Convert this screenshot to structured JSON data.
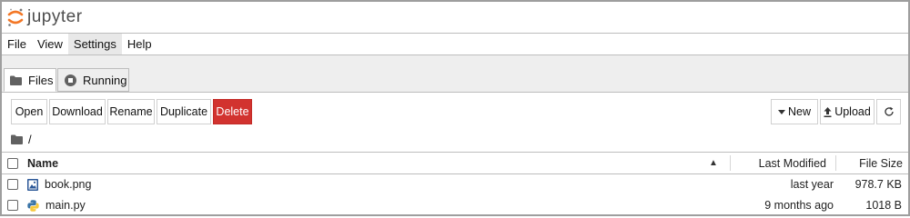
{
  "app": {
    "logo_text": "jupyter"
  },
  "menu": {
    "items": [
      "File",
      "View",
      "Settings",
      "Help"
    ],
    "active": "Settings"
  },
  "tabs": [
    {
      "label": "Files",
      "icon": "folder-icon",
      "selected": true
    },
    {
      "label": "Running",
      "icon": "stop-circle-icon",
      "selected": false
    }
  ],
  "toolbar": {
    "open_label": "Open",
    "download_label": "Download",
    "rename_label": "Rename",
    "duplicate_label": "Duplicate",
    "delete_label": "Delete",
    "new_label": "New",
    "upload_label": "Upload",
    "refresh_icon": "refresh-icon"
  },
  "breadcrumb": {
    "path": "/"
  },
  "table": {
    "columns": {
      "name": "Name",
      "last_modified": "Last Modified",
      "file_size": "File Size"
    },
    "sort_indicator": "▲",
    "rows": [
      {
        "name": "book.png",
        "modified": "last year",
        "size": "978.7 KB",
        "icon": "image-file-icon"
      },
      {
        "name": "main.py",
        "modified": "9 months ago",
        "size": "1018 B",
        "icon": "python-file-icon"
      }
    ]
  },
  "colors": {
    "delete_button": "#d2332f",
    "jupyter_orange": "#f37726",
    "tab_bg": "#eeeeee"
  }
}
